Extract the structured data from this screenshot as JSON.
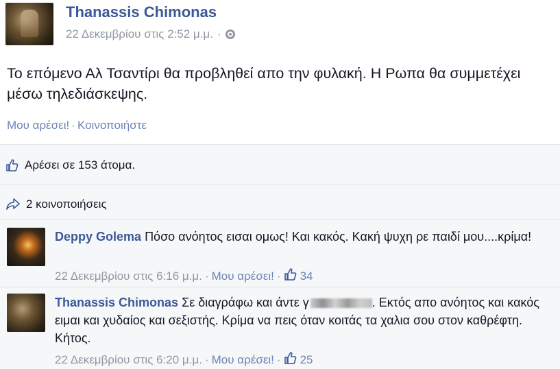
{
  "post": {
    "author": "Thanassis Chimonas",
    "timestamp": "22 Δεκεμβρίου στις 2:52 μ.μ.",
    "meta_sep": "·",
    "privacy_icon": "globe-icon",
    "text": "Το επόμενο Αλ Τσαντίρι θα προβληθεί απο την φυλακή. Η Ρωπα θα συμμετέχει μέσω τηλεδιάσκεψης.",
    "like_label": "Μου αρέσει!",
    "action_sep": "·",
    "share_label": "Κοινοποιήστε"
  },
  "feedback": {
    "likes_text": "Αρέσει σε 153 άτομα.",
    "shares_text": "2 κοινοποιήσεις"
  },
  "comments": [
    {
      "author": "Deppy Golema",
      "text": "Πόσο ανόητος εισαι ομως! Και κακός. Κακή ψυχη ρε παιδί μου....κρίμα!",
      "timestamp": "22 Δεκεμβρίου στις 6:16 μ.μ.",
      "sep": "·",
      "like_label": "Μου αρέσει!",
      "sep2": "·",
      "like_count": "34"
    },
    {
      "author": "Thanassis Chimonas",
      "text_before": "Σε διαγράφω και άντε γ",
      "text_after": ". Εκτός απο ανόητος και κακός ειμαι και χυδαίος και σεξιστής. Κρίμα να πεις όταν κοιτάς τα χαλια σου στον καθρέφτη. Κήτος.",
      "timestamp": "22 Δεκεμβρίου στις 6:20 μ.μ.",
      "sep": "·",
      "like_label": "Μου αρέσει!",
      "sep2": "·",
      "like_count": "25"
    }
  ],
  "colors": {
    "link_blue": "#3b5998",
    "action_blue": "#6d84b4",
    "meta_gray": "#9197a3",
    "feedback_bg": "#f6f7f9"
  }
}
